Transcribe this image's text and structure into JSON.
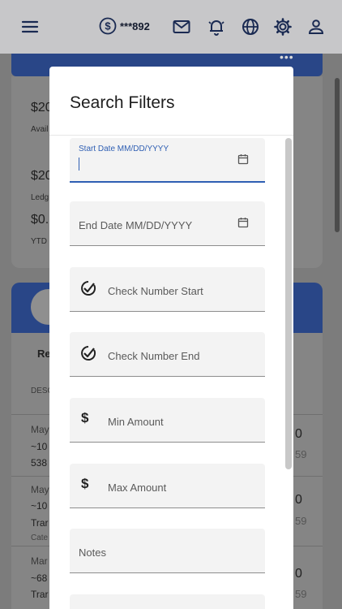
{
  "topbar": {
    "account_masked": "***892",
    "icons": [
      "menu-icon",
      "dollar-circle-icon",
      "mail-icon",
      "bell-icon",
      "globe-icon",
      "gear-icon",
      "user-icon"
    ]
  },
  "background": {
    "balance_1": "$20",
    "label_1": "Avail",
    "balance_2": "$20",
    "label_2": "Ledg",
    "balance_3": "$0.",
    "label_3": "YTD",
    "tab_label": "Re",
    "col_header": "DESC",
    "rows": [
      {
        "date": "May",
        "line2": "~10",
        "line3": "538",
        "amount": "0",
        "sub": "59"
      },
      {
        "date": "May",
        "line2": "~10",
        "line3": "Trar",
        "line4": "Cate",
        "amount": "0",
        "sub": "59"
      },
      {
        "date": "Mar",
        "line2": "~68",
        "line3": "Trar",
        "amount": "0",
        "sub": "59"
      }
    ]
  },
  "modal": {
    "title": "Search Filters",
    "fields": {
      "start_date": {
        "floating_label": "Start Date MM/DD/YYYY"
      },
      "end_date": {
        "label": "End Date MM/DD/YYYY"
      },
      "check_start": {
        "label": "Check Number Start"
      },
      "check_end": {
        "label": "Check Number End"
      },
      "min_amount": {
        "label": "Min Amount",
        "prefix": "$"
      },
      "max_amount": {
        "label": "Max Amount",
        "prefix": "$"
      },
      "notes": {
        "label": "Notes"
      }
    }
  },
  "colors": {
    "accent": "#2f5fb3",
    "banner": "#1b3d8a",
    "icon": "#1a2a52"
  }
}
